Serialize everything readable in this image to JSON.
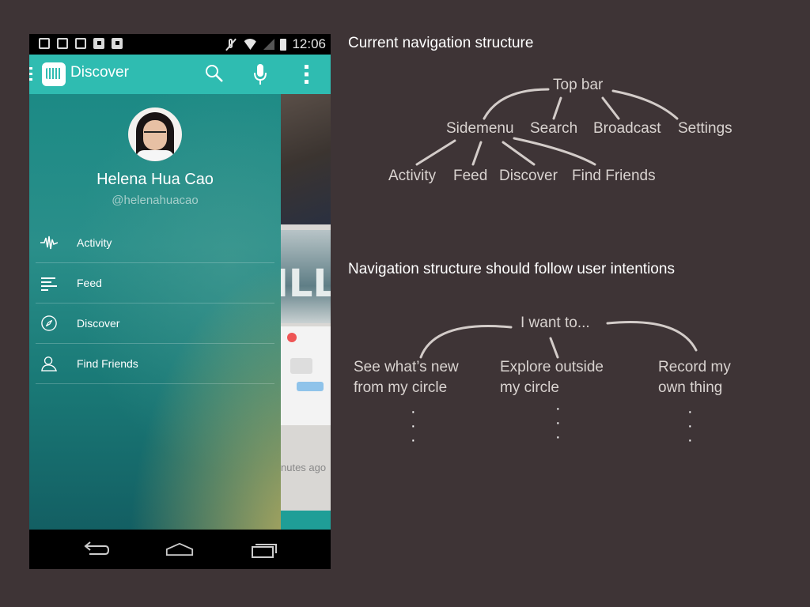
{
  "phone": {
    "status_bar": {
      "time": "12:06"
    },
    "app_bar": {
      "title": "Discover",
      "icons": [
        "menu-dots-icon",
        "app-logo-icon",
        "search-icon",
        "microphone-icon",
        "overflow-menu-icon"
      ]
    },
    "drawer": {
      "user": {
        "name": "Helena Hua Cao",
        "handle": "@helenahuacao"
      },
      "items": [
        {
          "label": "Activity",
          "icon": "activity-waveform-icon"
        },
        {
          "label": "Feed",
          "icon": "feed-lines-icon"
        },
        {
          "label": "Discover",
          "icon": "compass-icon"
        },
        {
          "label": "Find Friends",
          "icon": "person-icon"
        }
      ]
    },
    "background_content": {
      "timestamp_fragment": "nutes ago"
    },
    "nav_bar": {
      "buttons": [
        "back-icon",
        "home-icon",
        "recent-apps-icon"
      ]
    }
  },
  "annotations": {
    "current": {
      "heading": "Current navigation structure",
      "root": "Top bar",
      "level1": [
        "Sidemenu",
        "Search",
        "Broadcast",
        "Settings"
      ],
      "level2": [
        "Activity",
        "Feed",
        "Discover",
        "Find Friends"
      ]
    },
    "proposed": {
      "heading": "Navigation structure should follow user intentions",
      "root": "I want to...",
      "branches": [
        {
          "line1": "See what’s new",
          "line2": "from my circle"
        },
        {
          "line1": "Explore outside",
          "line2": "my circle"
        },
        {
          "line1": "Record my",
          "line2": "own thing"
        }
      ],
      "ellipsis": "·"
    }
  },
  "colors": {
    "background": "#3e3436",
    "app_bar": "#2fbcb1",
    "drawer": "#1c8a85"
  }
}
